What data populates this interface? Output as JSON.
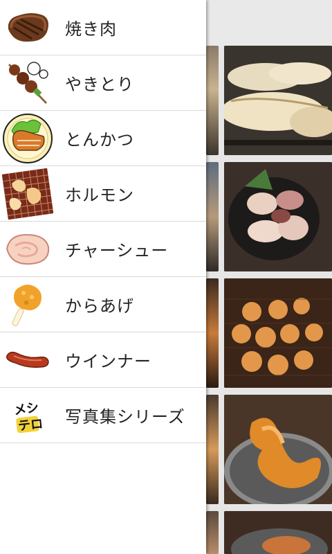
{
  "drawer": {
    "items": [
      {
        "label": "焼き肉",
        "icon": "grilled-steak-icon"
      },
      {
        "label": "やきとり",
        "icon": "yakitori-skewer-icon"
      },
      {
        "label": "とんかつ",
        "icon": "tonkatsu-plate-icon"
      },
      {
        "label": "ホルモン",
        "icon": "horumon-grill-icon"
      },
      {
        "label": "チャーシュー",
        "icon": "chashu-slice-icon"
      },
      {
        "label": "からあげ",
        "icon": "karaage-icon"
      },
      {
        "label": "ウインナー",
        "icon": "sausage-icon"
      },
      {
        "label": "写真集シリーズ",
        "icon": "meshi-tero-logo-icon"
      }
    ]
  },
  "logo_text": {
    "line1": "メシ",
    "line2": "テロ"
  }
}
